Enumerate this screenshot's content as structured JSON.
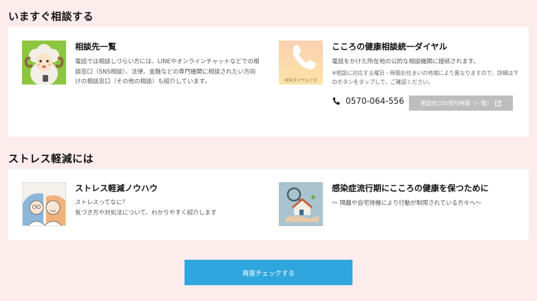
{
  "sections": {
    "consult_now": {
      "title": "いますぐ相談する"
    },
    "stress": {
      "title": "ストレス軽減には"
    }
  },
  "cards": {
    "consult_list": {
      "title": "相談先一覧",
      "desc": "電話では相談しづらい方には、LINEやオンラインチャットなどでの相談窓口（SNS相談）、法律、金融などの専門機関に相談されたい方向けの相談窓口（その他の相談）も紹介しています。"
    },
    "dial": {
      "title": "こころの健康相談統一ダイヤル",
      "thumb_caption": "有料ダイヤルです",
      "desc": "電話をかけた所在地の公的な相談機関に接続されます。",
      "note": "※相談に対応する曜日・時間お住まいの地域により異なりますので、詳細は下のボタンをタップして、ご確認ください。",
      "phone": "0570-064-556",
      "hours_button": "相談窓口の受付時間（一覧）"
    },
    "stress_knowhow": {
      "title": "ストレス軽減ノウハウ",
      "desc_line1": "ストレスってなに？",
      "desc_line2": "気づき方や対処法について、わかりやすく紹介します"
    },
    "pandemic": {
      "title": "感染症流行期にこころの健康を保つために",
      "desc": "～ 隔離や自宅待機により行動が制限されている方々へ～"
    }
  },
  "recheck_button": "再度チェックする",
  "colors": {
    "background": "#fdecec",
    "panel": "#ffffff",
    "accent_blue": "#2fa6dd",
    "disabled_button": "#bdbdbd"
  }
}
